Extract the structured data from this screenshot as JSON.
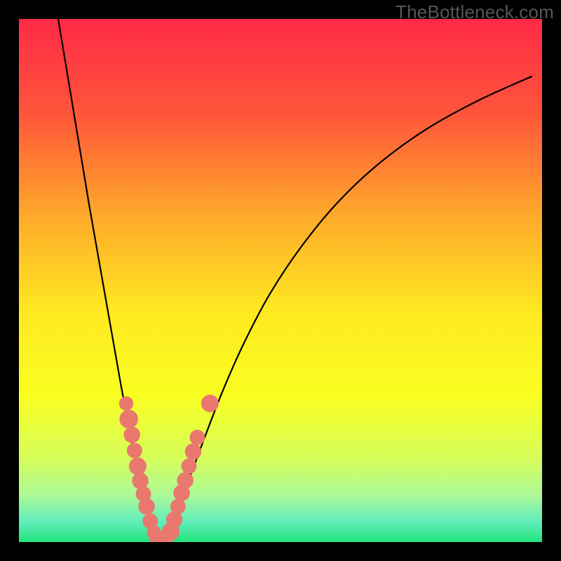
{
  "watermark": "TheBottleneck.com",
  "chart_data": {
    "type": "line",
    "title": "",
    "xlabel": "",
    "ylabel": "",
    "xlim": [
      0,
      100
    ],
    "ylim": [
      0,
      100
    ],
    "background": {
      "gradient_stops": [
        {
          "offset": 0,
          "color": "#ff2a46"
        },
        {
          "offset": 18,
          "color": "#fe553a"
        },
        {
          "offset": 38,
          "color": "#feab2a"
        },
        {
          "offset": 56,
          "color": "#fee921"
        },
        {
          "offset": 72,
          "color": "#f9fe21"
        },
        {
          "offset": 84,
          "color": "#d6fd5b"
        },
        {
          "offset": 91,
          "color": "#aef996"
        },
        {
          "offset": 96,
          "color": "#63edbb"
        },
        {
          "offset": 100,
          "color": "#23e47c"
        }
      ]
    },
    "series": [
      {
        "name": "left-arm",
        "x": [
          7.5,
          9.0,
          10.5,
          12.0,
          13.5,
          15.0,
          16.5,
          18.0,
          19.5,
          21.0,
          22.5,
          24.0,
          25.0,
          26.0
        ],
        "y": [
          100,
          91.0,
          82.0,
          73.0,
          64.0,
          55.5,
          47.0,
          38.5,
          30.0,
          22.0,
          14.5,
          7.5,
          3.0,
          0.5
        ]
      },
      {
        "name": "right-arm",
        "x": [
          28.0,
          30.0,
          32.5,
          35.5,
          39.0,
          43.0,
          48.0,
          54.0,
          61.0,
          69.0,
          78.0,
          88.0,
          98.0
        ],
        "y": [
          0.5,
          5.0,
          12.0,
          20.0,
          29.0,
          38.0,
          47.5,
          56.5,
          65.0,
          72.5,
          79.0,
          84.5,
          89.0
        ]
      }
    ],
    "scatter": {
      "name": "dots",
      "color": "#e9786f",
      "points": [
        {
          "x": 20.5,
          "y": 26.5,
          "r": 1.3
        },
        {
          "x": 21.0,
          "y": 23.5,
          "r": 1.7
        },
        {
          "x": 21.6,
          "y": 20.5,
          "r": 1.5
        },
        {
          "x": 22.1,
          "y": 17.5,
          "r": 1.4
        },
        {
          "x": 22.7,
          "y": 14.5,
          "r": 1.6
        },
        {
          "x": 23.2,
          "y": 11.7,
          "r": 1.5
        },
        {
          "x": 23.8,
          "y": 9.2,
          "r": 1.4
        },
        {
          "x": 24.4,
          "y": 6.8,
          "r": 1.5
        },
        {
          "x": 25.1,
          "y": 4.0,
          "r": 1.4
        },
        {
          "x": 25.8,
          "y": 1.8,
          "r": 1.3
        },
        {
          "x": 26.6,
          "y": 0.6,
          "r": 1.5
        },
        {
          "x": 27.3,
          "y": 0.3,
          "r": 1.6
        },
        {
          "x": 28.2,
          "y": 0.6,
          "r": 1.4
        },
        {
          "x": 29.0,
          "y": 2.0,
          "r": 1.6
        },
        {
          "x": 29.7,
          "y": 4.3,
          "r": 1.5
        },
        {
          "x": 30.4,
          "y": 6.8,
          "r": 1.4
        },
        {
          "x": 31.1,
          "y": 9.4,
          "r": 1.5
        },
        {
          "x": 31.8,
          "y": 11.8,
          "r": 1.5
        },
        {
          "x": 32.5,
          "y": 14.5,
          "r": 1.4
        },
        {
          "x": 33.3,
          "y": 17.3,
          "r": 1.5
        },
        {
          "x": 34.1,
          "y": 20.0,
          "r": 1.4
        },
        {
          "x": 36.5,
          "y": 26.5,
          "r": 1.6
        }
      ]
    }
  }
}
